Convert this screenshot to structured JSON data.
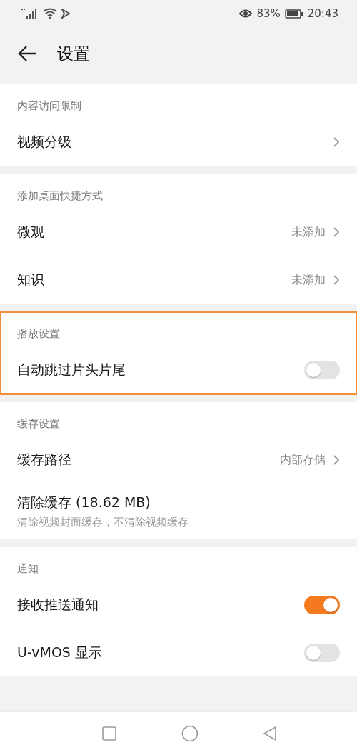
{
  "status_bar": {
    "battery": "83%",
    "time": "20:43"
  },
  "header": {
    "title": "设置"
  },
  "sections": [
    {
      "title": "内容访问限制",
      "highlighted": false,
      "rows": [
        {
          "kind": "link",
          "label": "视频分级"
        }
      ]
    },
    {
      "title": "添加桌面快捷方式",
      "highlighted": false,
      "rows": [
        {
          "kind": "link",
          "label": "微观",
          "value": "未添加"
        },
        {
          "kind": "link",
          "label": "知识",
          "value": "未添加"
        }
      ]
    },
    {
      "title": "播放设置",
      "highlighted": true,
      "rows": [
        {
          "kind": "toggle",
          "label": "自动跳过片头片尾",
          "on": false
        }
      ]
    },
    {
      "title": "缓存设置",
      "highlighted": false,
      "rows": [
        {
          "kind": "link",
          "label": "缓存路径",
          "value": "内部存储"
        },
        {
          "kind": "action",
          "label": "清除缓存 (18.62 MB)",
          "subtitle": "清除视频封面缓存，不清除视频缓存"
        }
      ]
    },
    {
      "title": "通知",
      "highlighted": false,
      "rows": [
        {
          "kind": "toggle",
          "label": "接收推送通知",
          "on": true
        },
        {
          "kind": "toggle",
          "label": "U-vMOS 显示",
          "on": false
        }
      ]
    }
  ]
}
